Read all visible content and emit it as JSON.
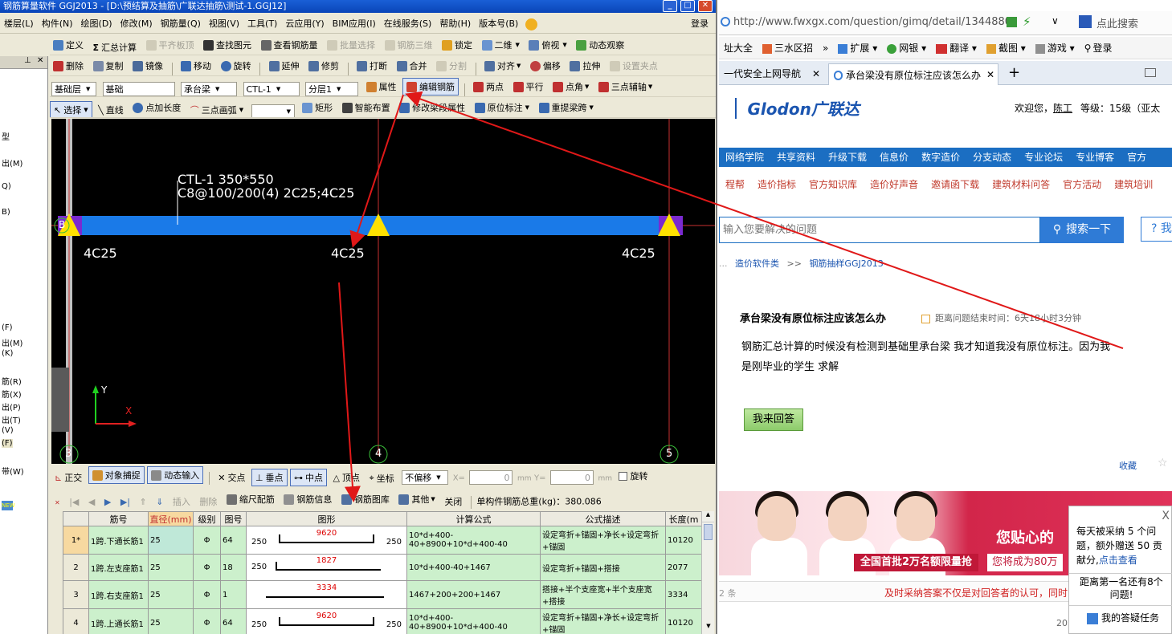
{
  "app": {
    "title": "钢筋算量软件 GGJ2013 - [D:\\预结算及抽筋\\广联达抽筋\\测试-1.GGJ12]",
    "menus": [
      "楼层(L)",
      "构件(N)",
      "绘图(D)",
      "修改(M)",
      "钢筋量(Q)",
      "视图(V)",
      "工具(T)",
      "云应用(Y)",
      "BIM应用(I)",
      "在线服务(S)",
      "帮助(H)",
      "版本号(B)"
    ],
    "login": "登录",
    "toolbar1": {
      "define": "定义",
      "sum": "汇总计算",
      "flat_top": "平齐板顶",
      "find": "查找图元",
      "view_rebar": "查看钢筋量",
      "batch_select": "批量选择",
      "rebar3d": "钢筋三维",
      "lock": "锁定",
      "view2d": "二维",
      "topview": "俯视",
      "dynamic": "动态观察"
    },
    "toolbar2": {
      "delete": "删除",
      "copy": "复制",
      "mirror": "镜像",
      "move": "移动",
      "rotate": "旋转",
      "extend": "延伸",
      "trim": "修剪",
      "break": "打断",
      "merge": "合并",
      "split": "分割",
      "align": "对齐",
      "offset": "偏移",
      "stretch": "拉伸",
      "set_grip": "设置夹点"
    },
    "toolbar3": {
      "layer": "基础层",
      "category": "基础",
      "type": "承台梁",
      "component": "CTL-1",
      "sublayer": "分层1",
      "properties": "属性",
      "edit_rebar": "编辑钢筋",
      "two_point": "两点",
      "parallel": "平行",
      "point_angle": "点角",
      "three_point_axis": "三点辅轴"
    },
    "toolbar4": {
      "select": "选择",
      "line": "直线",
      "point_length": "点加长度",
      "arc": "三点画弧",
      "rect": "矩形",
      "smart_layout": "智能布置",
      "modify_span": "修改梁段属性",
      "in_situ_label": "原位标注",
      "reextract_span": "重提梁跨"
    },
    "left_panel": {
      "items": [
        "型",
        "出(M)",
        "Q)",
        "B)",
        "(F)",
        "出(M)",
        "(K)",
        "筋(R)",
        "筋(X)",
        "出(P)",
        "出(T)",
        "(V)",
        "(F)",
        "带(W)"
      ]
    },
    "canvas": {
      "beam_label_line1": "CTL-1 350*550",
      "beam_label_line2": "C8@100/200(4) 2C25;4C25",
      "bottom_labels": [
        "4C25",
        "4C25",
        "4C25"
      ],
      "axis_numbers": [
        "3",
        "4",
        "5"
      ],
      "side_axis": "B",
      "ucs_y": "Y",
      "ucs_x": "X"
    },
    "snapbar": {
      "ortho": "正交",
      "object_snap": "对象捕捉",
      "dynamic_input": "动态输入",
      "intersection": "交点",
      "perpendicular": "垂点",
      "midpoint": "中点",
      "vertex": "顶点",
      "coordinate": "坐标",
      "offset_mode": "不偏移",
      "x_label": "X=",
      "y_label": "Y=",
      "x_value": "0",
      "y_value": "0",
      "unit": "mm",
      "rotate": "旋转"
    },
    "rebarbar": {
      "insert": "插入",
      "remove": "删除",
      "scale_rebar": "缩尺配筋",
      "rebar_info": "钢筋信息",
      "rebar_library": "钢筋图库",
      "other": "其他",
      "close": "关闭",
      "total_label": "单构件钢筋总重(kg)：380.086"
    },
    "grid": {
      "headers": [
        "筋号",
        "直径(mm)",
        "级别",
        "图号",
        "图形",
        "计算公式",
        "公式描述",
        "长度(m"
      ],
      "rows": [
        {
          "no": "1*",
          "name": "1跨.下通长筋1",
          "dia": "25",
          "grade": "Φ",
          "fig": "64",
          "left": "250",
          "mid": "9620",
          "right": "250",
          "formula": "10*d+400-40+8900+10*d+400-40",
          "desc": "设定弯折+锚固+净长+设定弯折+锚固",
          "len": "10120"
        },
        {
          "no": "2",
          "name": "1跨.左支座筋1",
          "dia": "25",
          "grade": "Φ",
          "fig": "18",
          "left": "250",
          "mid": "1827",
          "right": "",
          "formula": "10*d+400-40+1467",
          "desc": "设定弯折+锚固+搭接",
          "len": "2077"
        },
        {
          "no": "3",
          "name": "1跨.右支座筋1",
          "dia": "25",
          "grade": "Φ",
          "fig": "1",
          "left": "",
          "mid": "3334",
          "right": "",
          "formula": "1467+200+200+1467",
          "desc": "搭接+半个支座宽+半个支座宽+搭接",
          "len": "3334"
        },
        {
          "no": "4",
          "name": "1跨.上通长筋1",
          "dia": "25",
          "grade": "Φ",
          "fig": "64",
          "left": "250",
          "mid": "9620",
          "right": "250",
          "formula": "10*d+400-40+8900+10*d+400-40",
          "desc": "设定弯折+锚固+净长+设定弯折+锚固",
          "len": "10120"
        }
      ]
    }
  },
  "browser": {
    "url": "http://www.fwxgx.com/question/gimq/detail/1344880",
    "search_placeholder": "点此搜索",
    "bookmarks": [
      "址大全",
      "三水区招",
      "扩展",
      "网银",
      "翻译",
      "截图",
      "游戏",
      "登录"
    ],
    "tabs": [
      "一代安全上网导航",
      "承台梁没有原位标注应该怎么办"
    ],
    "logo_text": "Glodon广联达",
    "welcome": "欢迎您，",
    "user": "陈工",
    "level": "等级：15级（亚太",
    "nav1": [
      "网络学院",
      "共享资料",
      "升级下载",
      "信息价",
      "数字造价",
      "分支动态",
      "专业论坛",
      "专业博客",
      "官方"
    ],
    "nav2": [
      "程帮",
      "造价指标",
      "官方知识库",
      "造价好声音",
      "邀请函下载",
      "建筑材料问答",
      "官方活动",
      "建筑培训"
    ],
    "site_search_placeholder": "输入您要解决的问题",
    "site_search_button": "搜索一下",
    "help_button": "? 我",
    "breadcrumb": [
      "造价软件类",
      "钢筋抽样GGJ2013"
    ],
    "question_title": "承台梁没有原位标注应该怎么办",
    "question_timer": "距离问题结束时间：6天18小时3分钟",
    "question_body_line1": "钢筋汇总计算的时候没有检测到基础里承台梁  我才知道我没有原位标注。因为我",
    "question_body_line2": "是刚毕业的学生  求解",
    "answer_button": "我来回答",
    "collect": "收藏",
    "banner": {
      "line1": "您贴心的",
      "line2": "全国首批2万名额限量抢",
      "line3": "您将成为80万"
    },
    "footer_left": "2 条",
    "footer_note": "及时采纳答案不仅是对回答者的认可，同时",
    "popup": {
      "line1": "每天被采纳 5 个问题，额外赠送 50 贡献分,",
      "link": "点击查看",
      "line2": "距离第一名还有8个问题!",
      "task": "我的答疑任务",
      "close": "X"
    },
    "page_number": "20"
  }
}
